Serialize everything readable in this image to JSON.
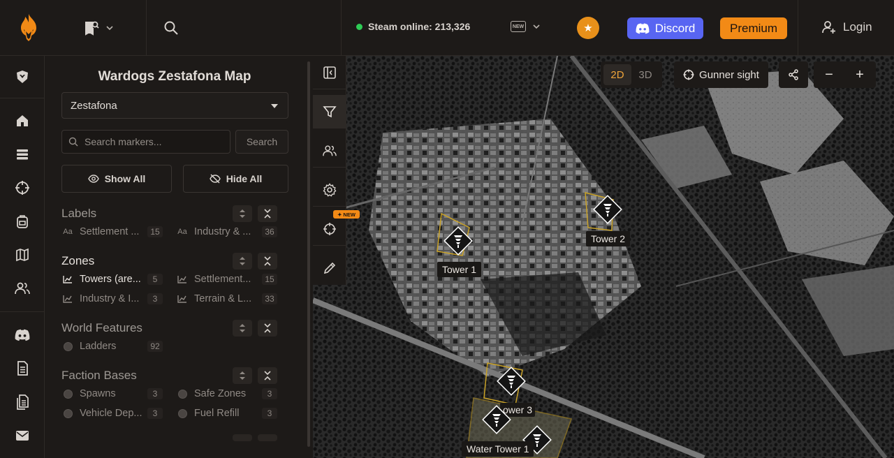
{
  "header": {
    "steam_status": "Steam online: 213,326",
    "new_badge_icon": "NEW",
    "discord_label": "Discord",
    "premium_label": "Premium",
    "login_label": "Login"
  },
  "panel": {
    "title": "Wardogs Zestafona Map",
    "map_select": "Zestafona",
    "search_placeholder": "Search markers...",
    "search_button": "Search",
    "show_all": "Show All",
    "hide_all": "Hide All"
  },
  "groups": {
    "labels": {
      "title": "Labels",
      "items": [
        {
          "label": "Settlement ...",
          "count": "15"
        },
        {
          "label": "Industry & ...",
          "count": "36"
        }
      ]
    },
    "zones": {
      "title": "Zones",
      "items": [
        {
          "label": "Towers (are...",
          "count": "5"
        },
        {
          "label": "Settlement...",
          "count": "15"
        },
        {
          "label": "Industry & I...",
          "count": "3"
        },
        {
          "label": "Terrain & L...",
          "count": "33"
        }
      ]
    },
    "world_features": {
      "title": "World Features",
      "items": [
        {
          "label": "Ladders",
          "count": "92"
        }
      ]
    },
    "faction_bases": {
      "title": "Faction Bases",
      "items": [
        {
          "label": "Spawns",
          "count": "3"
        },
        {
          "label": "Safe Zones",
          "count": "3"
        },
        {
          "label": "Vehicle Dep...",
          "count": "3"
        },
        {
          "label": "Fuel Refill",
          "count": "3"
        }
      ]
    }
  },
  "toolstrip": {
    "new_badge": "✦ NEW"
  },
  "map_controls": {
    "view_2d": "2D",
    "view_3d": "3D",
    "gunner_sight": "Gunner sight",
    "zoom_out": "−",
    "zoom_in": "+"
  },
  "markers": [
    {
      "label": "Tower 1"
    },
    {
      "label": "Tower 2"
    },
    {
      "label": "ower 3"
    },
    {
      "label": "Water Tower 1"
    }
  ],
  "colors": {
    "accent": "#f28a16",
    "discord": "#5865f2",
    "online": "#2ecc55",
    "zone_outline": "#c9a227"
  }
}
